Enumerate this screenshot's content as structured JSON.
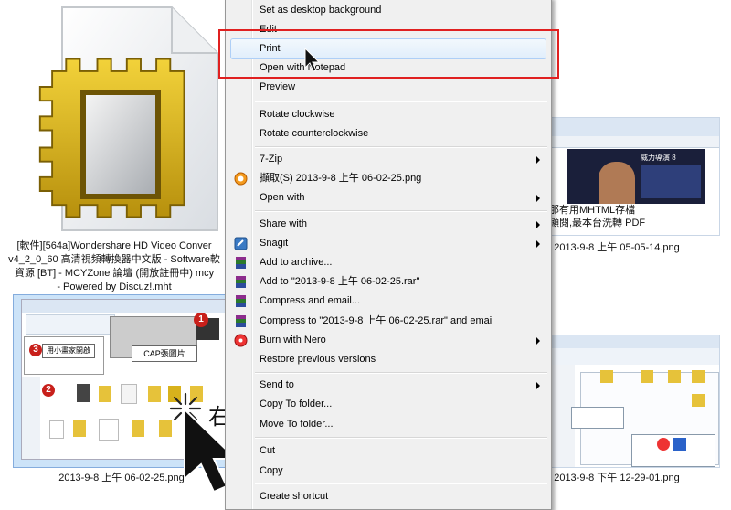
{
  "left_file": {
    "label_lines": [
      "[軟件][564a]Wondershare HD Video Conver",
      "v4_2_0_60 高清視頻轉換器中文版 - Software軟",
      "資源 [BT] - MCYZone 論壇 (開放註冊中) mcy",
      "- Powered by Discuz!.mht"
    ]
  },
  "thumbnails": {
    "selected_label": "2013-9-8 上午 06-02-25.png",
    "right_top_label": "2013-9-8 上午 05-05-14.png",
    "right_bottom_label": "2013-9-8 下午 12-29-01.png",
    "selected_inner": {
      "badge1": "1",
      "badge2": "2",
      "badge3": "3",
      "caption_cap": "CAP張圖片",
      "caption_open": "用小畫家開啟"
    },
    "right_top_text": {
      "line1": "那有用MHTML存檔",
      "line2": "顯閱,最本台洗轉 PDF",
      "banner": "威力導演 8"
    }
  },
  "context_menu": {
    "items": [
      {
        "label": "Set as desktop background"
      },
      {
        "label": "Edit"
      },
      {
        "label": "Print"
      },
      {
        "label": "Open with Notepad"
      },
      {
        "label": "Preview"
      },
      {
        "label": "Rotate clockwise"
      },
      {
        "label": "Rotate counterclockwise"
      },
      {
        "label": "7-Zip"
      },
      {
        "label": "擷取(S) 2013-9-8 上午 06-02-25.png"
      },
      {
        "label": "Open with"
      },
      {
        "label": "Share with"
      },
      {
        "label": "Snagit"
      },
      {
        "label": "Add to archive..."
      },
      {
        "label": "Add to \"2013-9-8 上午 06-02-25.rar\""
      },
      {
        "label": "Compress and email..."
      },
      {
        "label": "Compress to \"2013-9-8 上午 06-02-25.rar\" and email"
      },
      {
        "label": "Burn with Nero"
      },
      {
        "label": "Restore previous versions"
      },
      {
        "label": "Send to"
      },
      {
        "label": "Copy To folder..."
      },
      {
        "label": "Move To folder..."
      },
      {
        "label": "Cut"
      },
      {
        "label": "Copy"
      },
      {
        "label": "Create shortcut"
      }
    ]
  },
  "annotation": {
    "right_click_text": "右點"
  },
  "colors": {
    "menu_bg": "#f0f0f0",
    "highlight_border": "#aecff7",
    "red_box": "#e02020",
    "selection_bg": "#cce3f8",
    "icon_gold": "#d8b21c"
  }
}
